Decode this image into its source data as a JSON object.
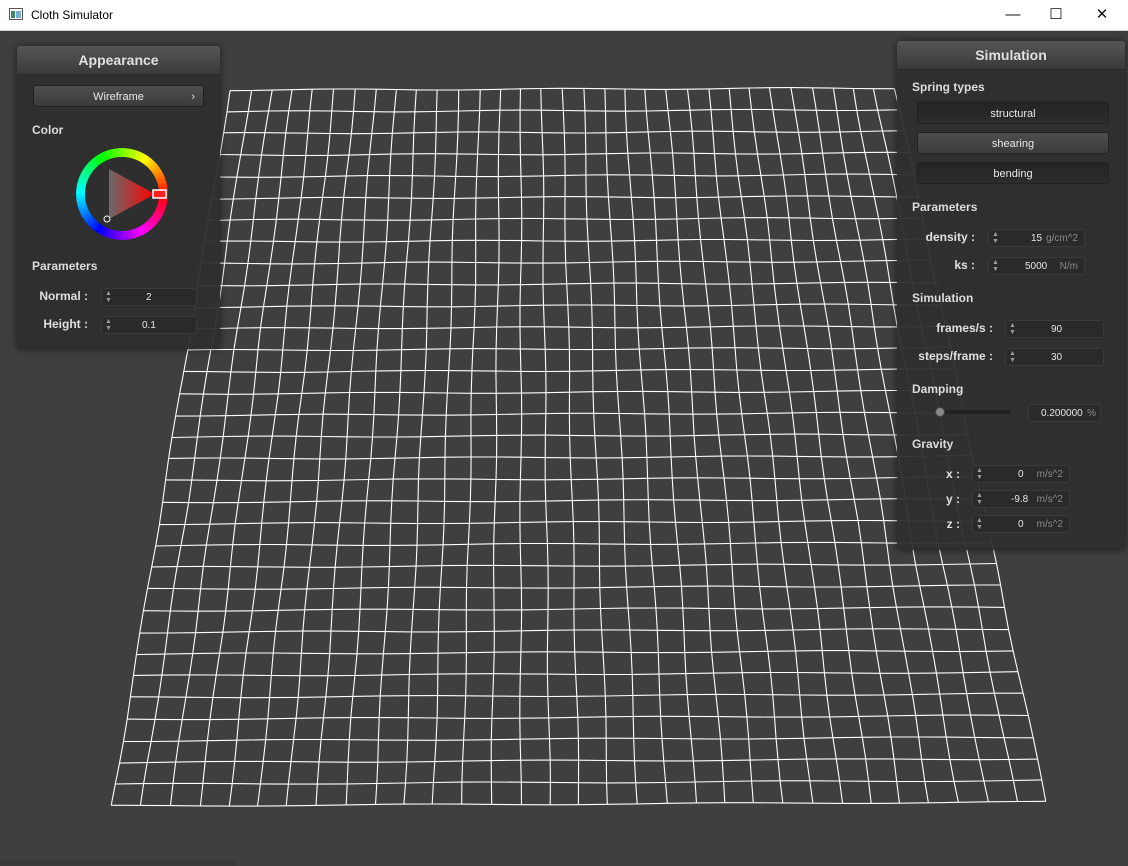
{
  "window": {
    "title": "Cloth Simulator",
    "icon": "app-window-icon",
    "minimize_glyph": "—",
    "maximize_glyph": "☐",
    "close_glyph": "✕"
  },
  "viewport": {
    "cloth_color": "#ffffff",
    "background_color": "#3f3f3f",
    "grid_rows": 33,
    "grid_cols": 32
  },
  "appearance": {
    "title": "Appearance",
    "mode_button": {
      "label": "Wireframe",
      "chevron": "›"
    },
    "color_label": "Color",
    "color_value": "#ff0000",
    "parameters_label": "Parameters",
    "fields": [
      {
        "label": "Normal :",
        "value": "2"
      },
      {
        "label": "Height :",
        "value": "0.1"
      }
    ]
  },
  "simulation": {
    "title": "Simulation",
    "spring_types_label": "Spring types",
    "springs": [
      {
        "label": "structural",
        "active": false
      },
      {
        "label": "shearing",
        "active": true
      },
      {
        "label": "bending",
        "active": false
      }
    ],
    "parameters_label": "Parameters",
    "parameters": [
      {
        "label": "density :",
        "value": "15",
        "unit": "g/cm^2"
      },
      {
        "label": "ks :",
        "value": "5000",
        "unit": "N/m"
      }
    ],
    "simulation_label": "Simulation",
    "sim_fields": [
      {
        "label": "frames/s :",
        "value": "90"
      },
      {
        "label": "steps/frame :",
        "value": "30"
      }
    ],
    "damping_label": "Damping",
    "damping": {
      "value": "0.200000",
      "unit": "%",
      "fraction": 0.02
    },
    "gravity_label": "Gravity",
    "gravity": [
      {
        "label": "x :",
        "value": "0",
        "unit": "m/s^2"
      },
      {
        "label": "y :",
        "value": "-9.8",
        "unit": "m/s^2"
      },
      {
        "label": "z :",
        "value": "0",
        "unit": "m/s^2"
      }
    ]
  }
}
